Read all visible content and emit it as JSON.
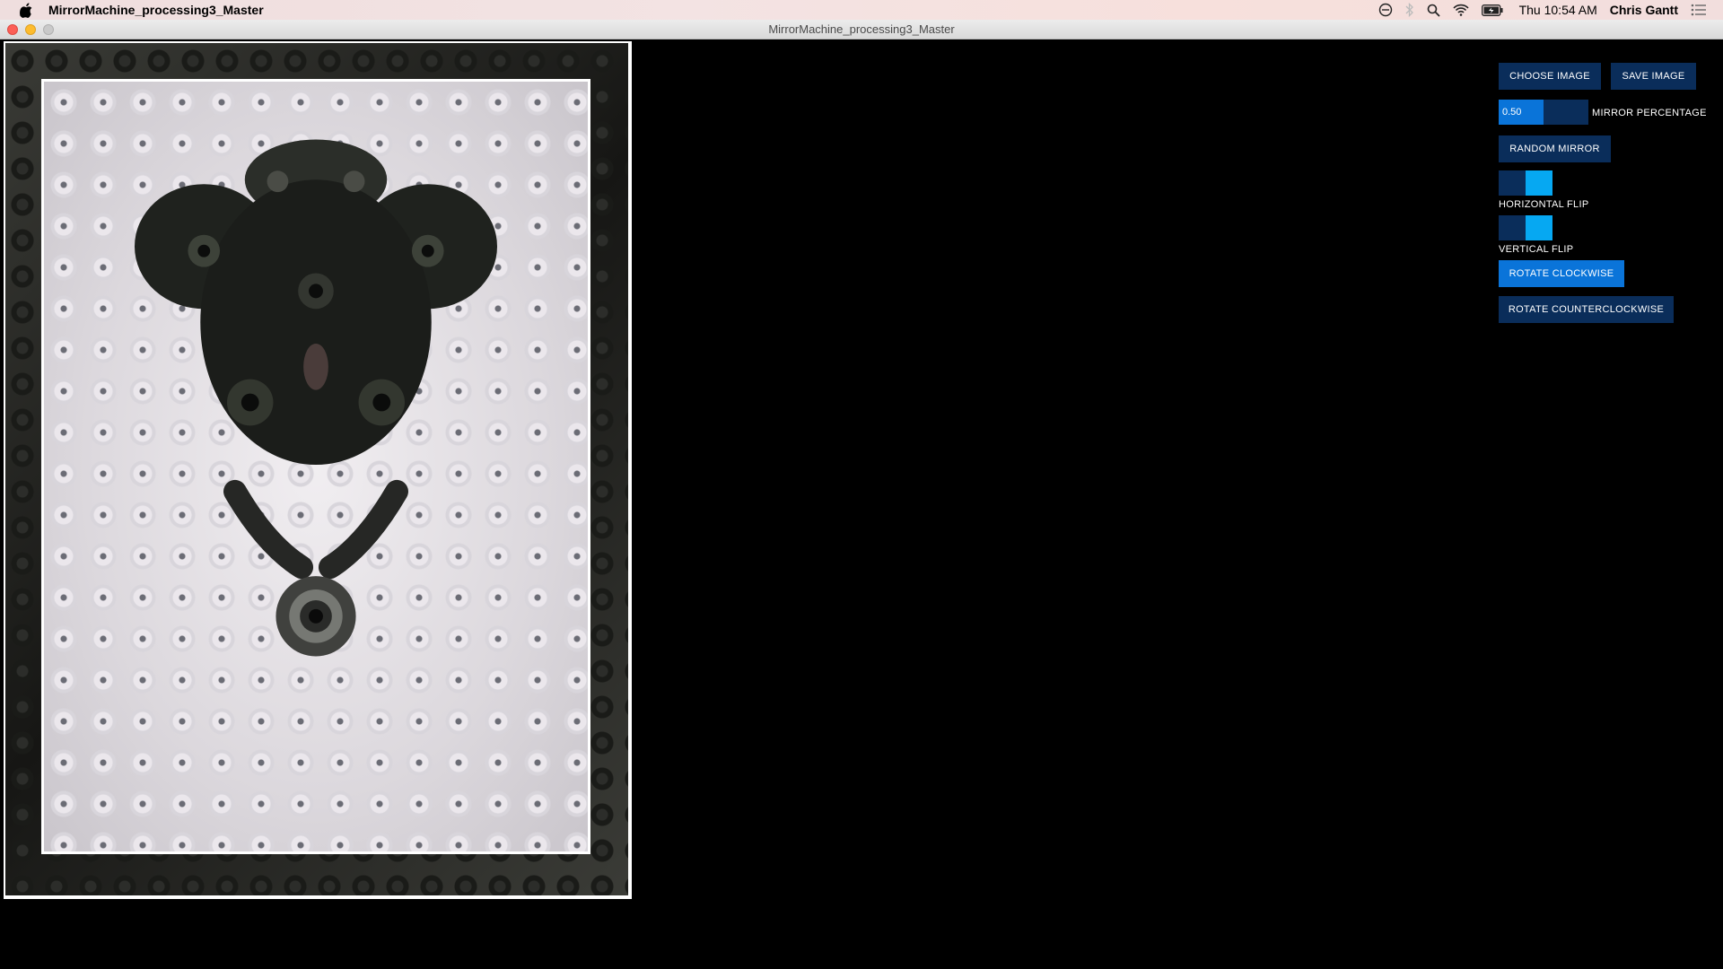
{
  "menubar": {
    "app_name": "MirrorMachine_processing3_Master",
    "clock": "Thu 10:54 AM",
    "user": "Chris Gantt",
    "icons": [
      "apple-icon",
      "do-not-disturb-icon",
      "bluetooth-icon",
      "spotlight-search-icon",
      "wifi-icon",
      "battery-icon",
      "notification-center-icon"
    ]
  },
  "window": {
    "title": "MirrorMachine_processing3_Master"
  },
  "controls": {
    "choose_image": "CHOOSE IMAGE",
    "save_image": "SAVE IMAGE",
    "mirror_percentage_value": "0.50",
    "mirror_percentage_fraction": 0.5,
    "mirror_percentage_label": "MIRROR PERCENTAGE",
    "random_mirror": "RANDOM MIRROR",
    "horizontal_flip_label": "HORIZONTAL FLIP",
    "horizontal_flip_on": true,
    "vertical_flip_label": "VERTICAL FLIP",
    "vertical_flip_on": true,
    "rotate_clockwise": "ROTATE CLOCKWISE",
    "rotate_counterclockwise": "ROTATE COUNTERCLOCKWISE"
  },
  "colors": {
    "button_dark": "#0a2d5a",
    "button_active": "#0a74d9",
    "toggle_on": "#06a8f2",
    "background": "#000000"
  }
}
